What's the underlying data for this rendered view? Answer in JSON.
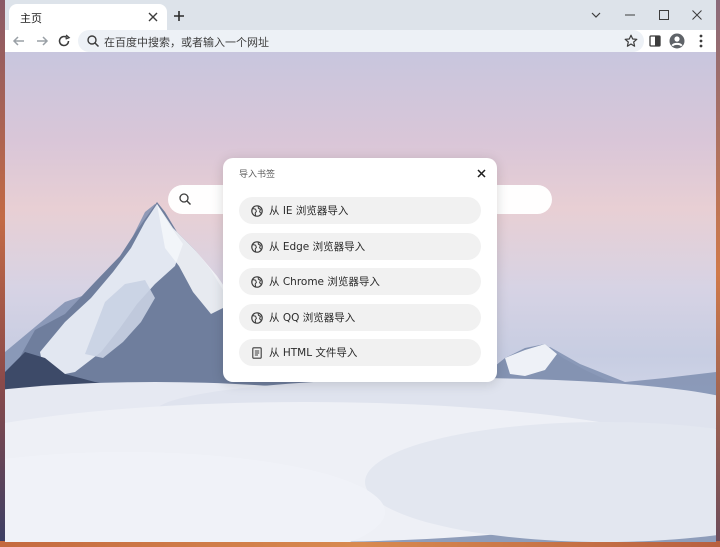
{
  "browser": {
    "tab": {
      "title": "主页"
    },
    "omnibox": {
      "placeholder": "在百度中搜索，或者输入一个网址"
    },
    "icons": {
      "tab_close": "close-icon",
      "new_tab": "plus-icon",
      "tab_search": "chevron-down-icon",
      "minimize": "minimize-icon",
      "maximize": "maximize-icon",
      "close": "close-icon",
      "back": "arrow-left-icon",
      "forward": "arrow-right-icon",
      "reload": "reload-icon",
      "search": "search-icon",
      "bookmark": "star-icon",
      "side_panel": "side-panel-icon",
      "profile": "avatar-icon"
    }
  },
  "dialog": {
    "title": "导入书签",
    "options": [
      {
        "label": "从 IE 浏览器导入",
        "icon": "globe-icon"
      },
      {
        "label": "从 Edge 浏览器导入",
        "icon": "globe-icon"
      },
      {
        "label": "从 Chrome 浏览器导入",
        "icon": "globe-icon"
      },
      {
        "label": "从 QQ 浏览器导入",
        "icon": "globe-icon"
      },
      {
        "label": "从 HTML 文件导入",
        "icon": "document-icon"
      }
    ]
  },
  "colors": {
    "tabstrip": "#dde3ea",
    "omnibox": "#edf1f6",
    "option_bg": "#f1f1f1"
  }
}
